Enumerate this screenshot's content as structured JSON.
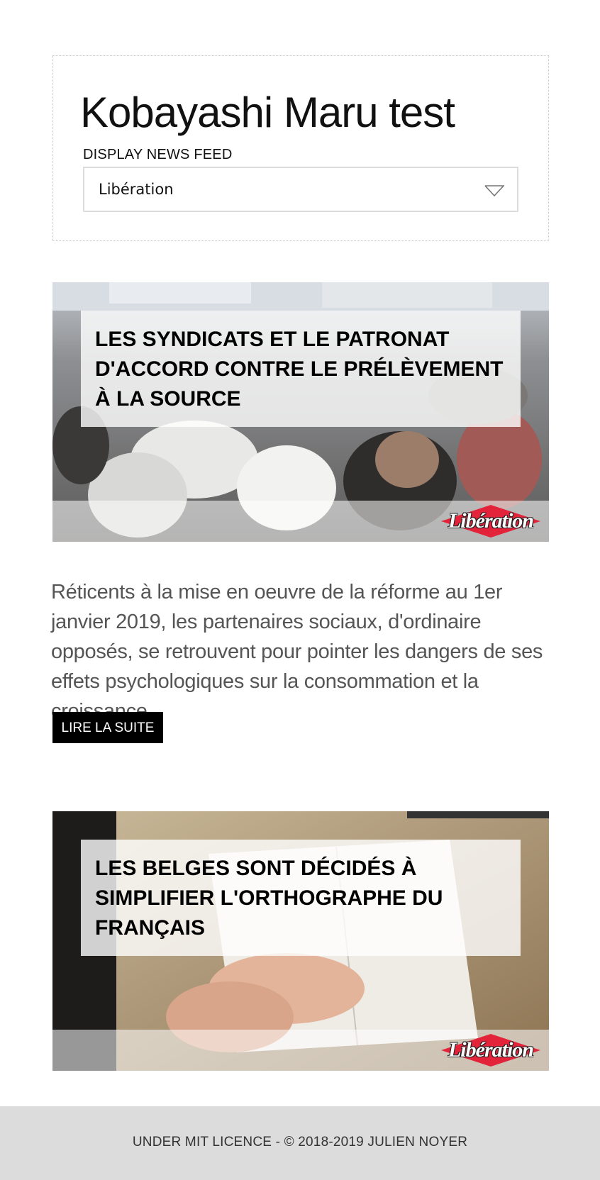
{
  "app": {
    "title": "Kobayashi Maru test",
    "feed_label": "DISPLAY NEWS FEED",
    "feed_selected": "Libération"
  },
  "articles": [
    {
      "title": "LES SYNDICATS ET LE PATRONAT D'ACCORD CONTRE LE PRÉLÈVEMENT À LA SOURCE",
      "image": "photo-conference-audience-bent-over",
      "source_logo": "Libération",
      "summary": "Réticents à la mise en oeuvre de la réforme au 1er janvier 2019, les partenaires sociaux, d'ordinaire opposés, se retrouvent pour pointer les dangers de ses effets psychologiques sur la consommation et la croissance.",
      "read_more": "LIRE LA SUITE"
    },
    {
      "title": "LES BELGES SONT DÉCIDÉS À SIMPLIFIER L'ORTHOGRAPHE DU FRANÇAIS",
      "image": "photo-hands-open-book-on-table",
      "source_logo": "Libération"
    }
  ],
  "footer": {
    "text": "UNDER MIT LICENCE - © 2018-2019 JULIEN NOYER"
  },
  "colors": {
    "logo_red": "#e2233a",
    "button_bg": "#000000",
    "footer_bg": "#dcdcdc"
  }
}
